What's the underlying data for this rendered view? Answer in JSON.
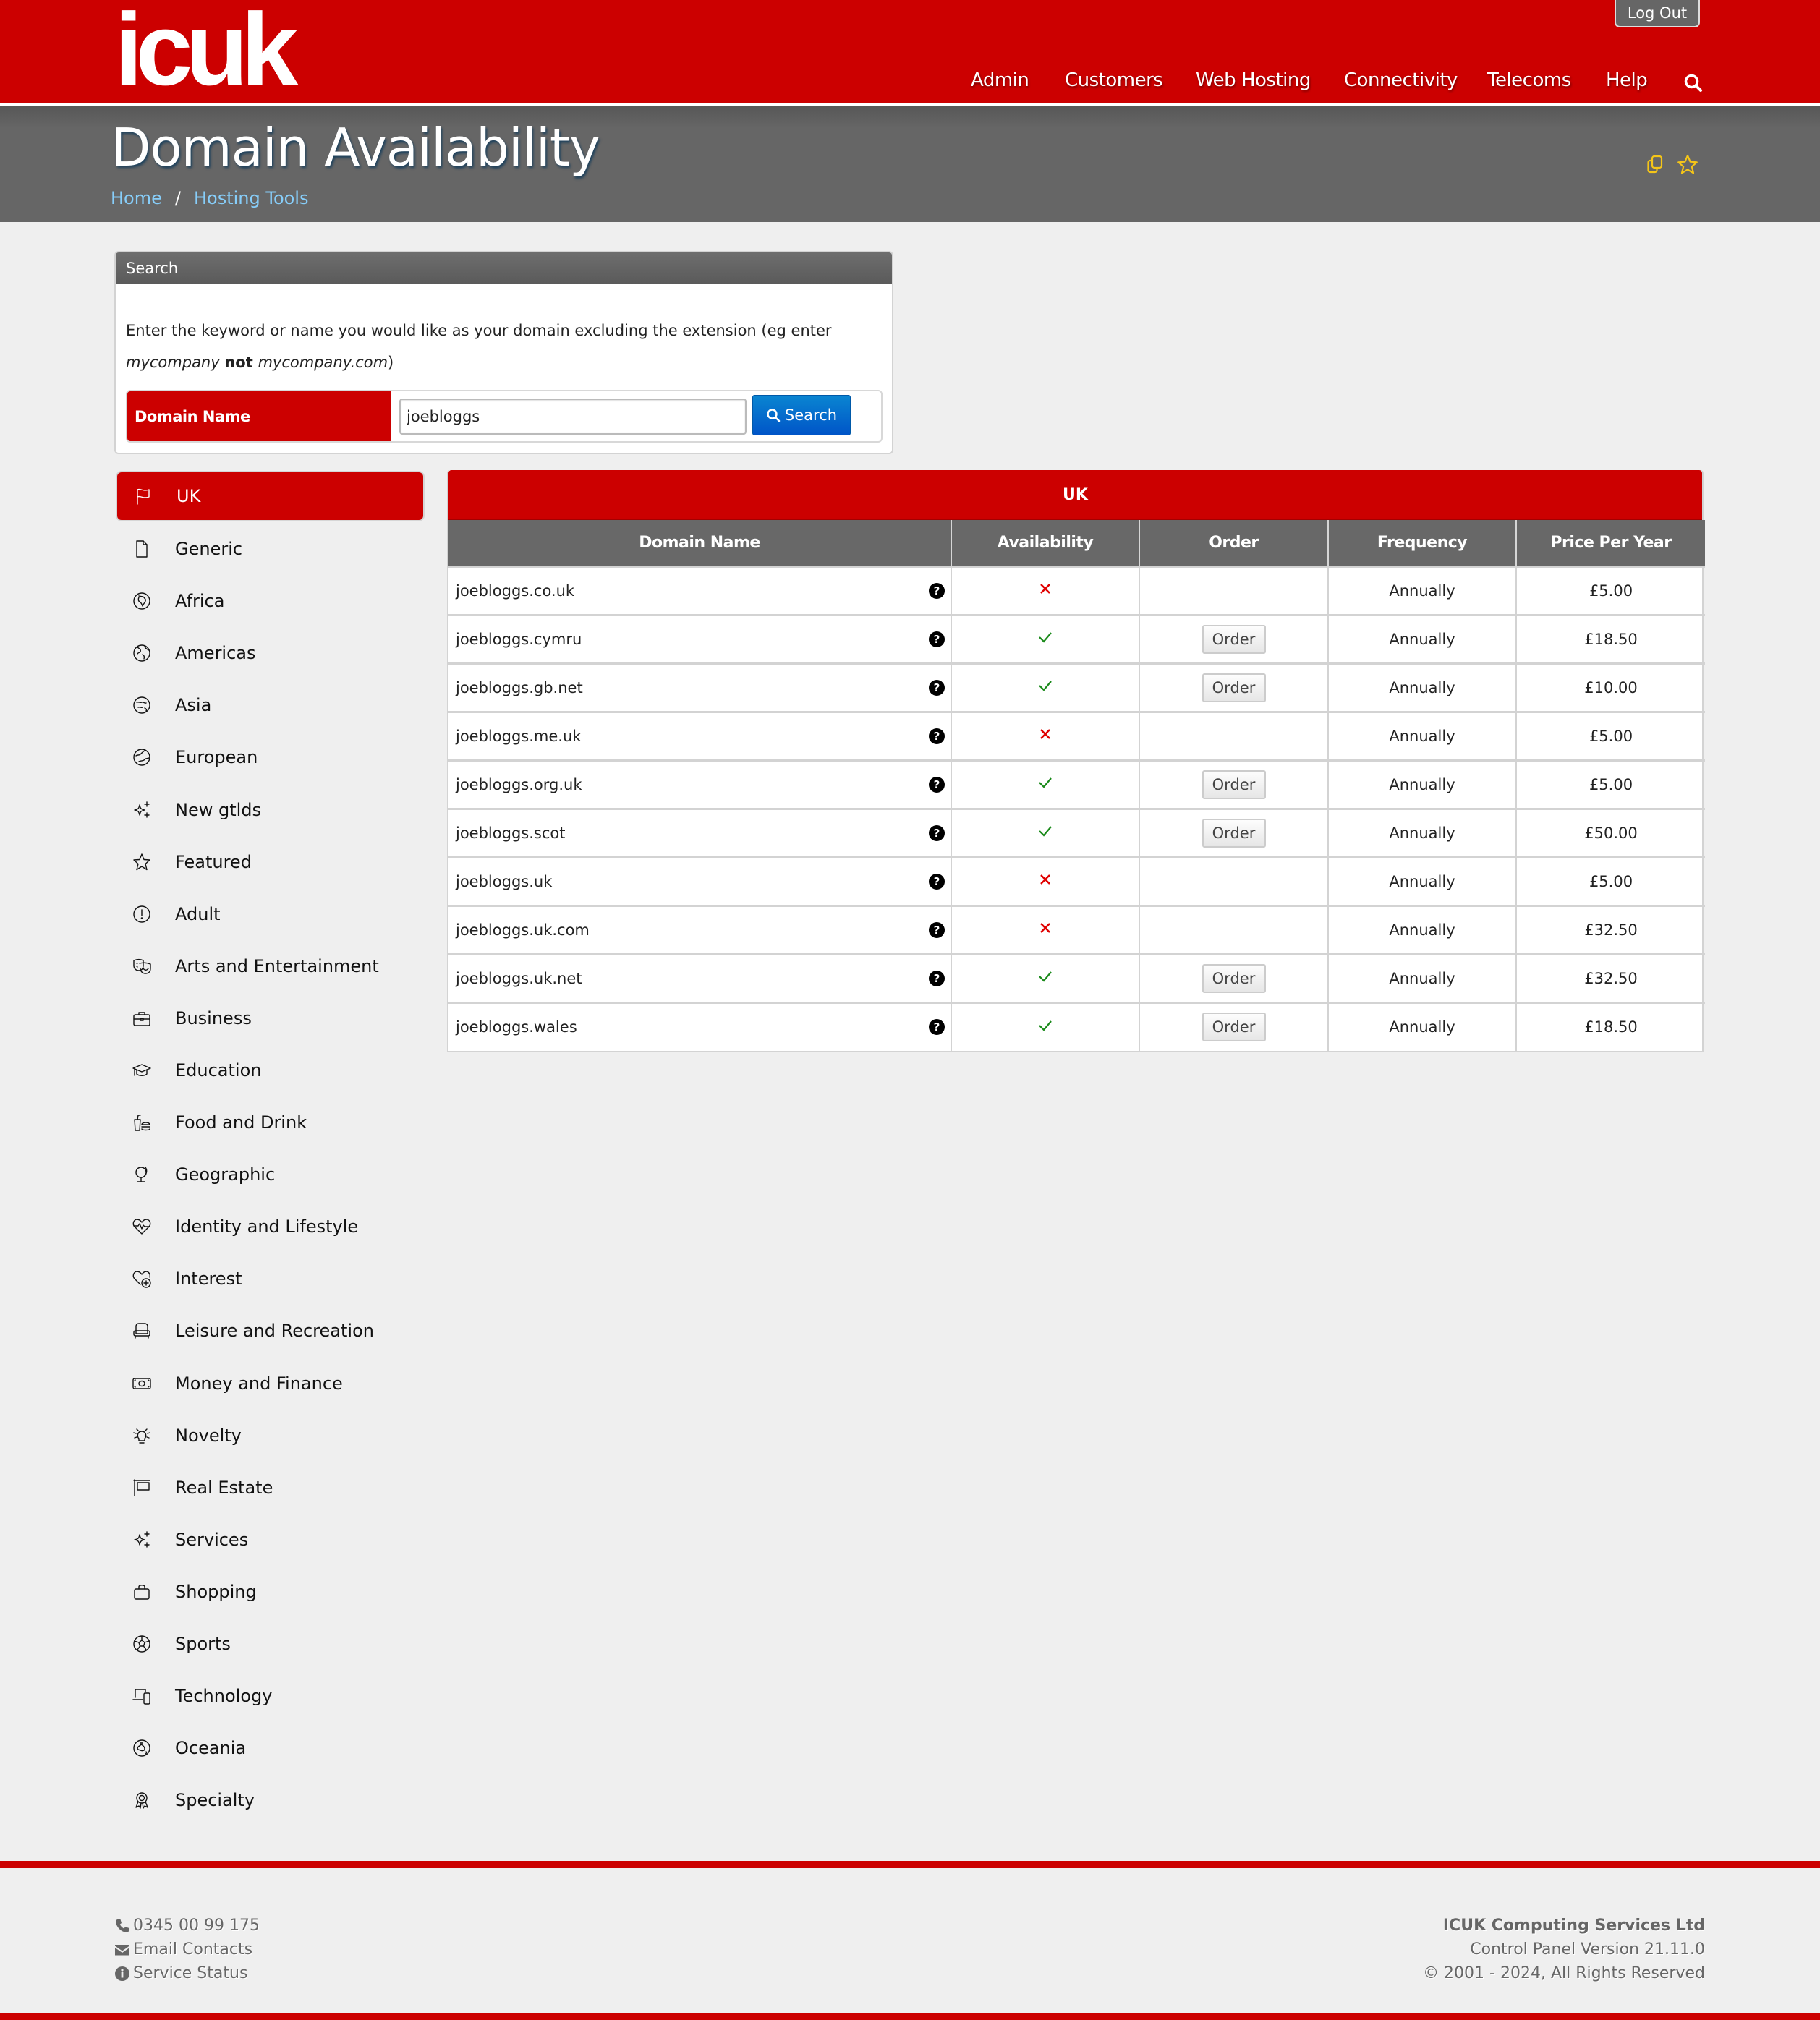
{
  "header": {
    "logo_text": "icuk",
    "logout_label": "Log Out",
    "nav": [
      "Admin",
      "Customers",
      "Web Hosting",
      "Connectivity",
      "Telecoms",
      "Help"
    ],
    "search_icon": "search-icon"
  },
  "title_band": {
    "title": "Domain Availability",
    "breadcrumb": [
      "Home",
      "Hosting Tools"
    ],
    "breadcrumb_separator": "/",
    "icons": [
      "copy-icon",
      "star-icon"
    ]
  },
  "search": {
    "panel_title": "Search",
    "help_text_1": "Enter the keyword or name you would like as your domain excluding the extension (eg enter ",
    "help_example_good": "mycompany",
    "help_not": "not",
    "help_example_bad": "mycompany.com",
    "help_close": ")",
    "field_label": "Domain Name",
    "field_value": "joebloggs",
    "button_label": "Search"
  },
  "sidebar": {
    "active": "UK",
    "items": [
      {
        "label": "UK",
        "icon": "flag-icon"
      },
      {
        "label": "Generic",
        "icon": "file-icon"
      },
      {
        "label": "Africa",
        "icon": "globe-africa-icon"
      },
      {
        "label": "Americas",
        "icon": "globe-americas-icon"
      },
      {
        "label": "Asia",
        "icon": "globe-asia-icon"
      },
      {
        "label": "European",
        "icon": "globe-europe-icon"
      },
      {
        "label": "New gtlds",
        "icon": "sparkles-icon"
      },
      {
        "label": "Featured",
        "icon": "star-icon"
      },
      {
        "label": "Adult",
        "icon": "exclamation-circle-icon"
      },
      {
        "label": "Arts and Entertainment",
        "icon": "theater-masks-icon"
      },
      {
        "label": "Business",
        "icon": "briefcase-icon"
      },
      {
        "label": "Education",
        "icon": "graduation-cap-icon"
      },
      {
        "label": "Food and Drink",
        "icon": "burger-soda-icon"
      },
      {
        "label": "Geographic",
        "icon": "desk-globe-icon"
      },
      {
        "label": "Identity and Lifestyle",
        "icon": "heart-pulse-icon"
      },
      {
        "label": "Interest",
        "icon": "heart-plus-icon"
      },
      {
        "label": "Leisure and Recreation",
        "icon": "couch-icon"
      },
      {
        "label": "Money and Finance",
        "icon": "money-bill-icon"
      },
      {
        "label": "Novelty",
        "icon": "lightbulb-icon"
      },
      {
        "label": "Real Estate",
        "icon": "sign-post-icon"
      },
      {
        "label": "Services",
        "icon": "sparkles-icon"
      },
      {
        "label": "Shopping",
        "icon": "shopping-bag-icon"
      },
      {
        "label": "Sports",
        "icon": "soccer-ball-icon"
      },
      {
        "label": "Technology",
        "icon": "laptop-mobile-icon"
      },
      {
        "label": "Oceania",
        "icon": "globe-oceania-icon"
      },
      {
        "label": "Specialty",
        "icon": "award-icon"
      }
    ]
  },
  "results": {
    "title": "UK",
    "columns": [
      "Domain Name",
      "Availability",
      "Order",
      "Frequency",
      "Price Per Year"
    ],
    "order_label": "Order",
    "colors": {
      "available": "#1a8a1a",
      "unavailable": "#e00000"
    },
    "rows": [
      {
        "domain": "joebloggs.co.uk",
        "available": false,
        "frequency": "Annually",
        "price": "£5.00"
      },
      {
        "domain": "joebloggs.cymru",
        "available": true,
        "frequency": "Annually",
        "price": "£18.50"
      },
      {
        "domain": "joebloggs.gb.net",
        "available": true,
        "frequency": "Annually",
        "price": "£10.00"
      },
      {
        "domain": "joebloggs.me.uk",
        "available": false,
        "frequency": "Annually",
        "price": "£5.00"
      },
      {
        "domain": "joebloggs.org.uk",
        "available": true,
        "frequency": "Annually",
        "price": "£5.00"
      },
      {
        "domain": "joebloggs.scot",
        "available": true,
        "frequency": "Annually",
        "price": "£50.00"
      },
      {
        "domain": "joebloggs.uk",
        "available": false,
        "frequency": "Annually",
        "price": "£5.00"
      },
      {
        "domain": "joebloggs.uk.com",
        "available": false,
        "frequency": "Annually",
        "price": "£32.50"
      },
      {
        "domain": "joebloggs.uk.net",
        "available": true,
        "frequency": "Annually",
        "price": "£32.50"
      },
      {
        "domain": "joebloggs.wales",
        "available": true,
        "frequency": "Annually",
        "price": "£18.50"
      }
    ]
  },
  "footer": {
    "phone": "0345 00 99 175",
    "email": "Email Contacts",
    "status": "Service Status",
    "company": "ICUK Computing Services Ltd",
    "version": "Control Panel Version 21.11.0",
    "copyright": "© 2001 - 2024, All Rights Reserved"
  },
  "colors": {
    "brand_red": "#cc0000",
    "header_grey": "#666666",
    "search_blue": "#0a6fd0",
    "link_blue": "#87cefa",
    "title_icon_yellow": "#f5c518"
  }
}
